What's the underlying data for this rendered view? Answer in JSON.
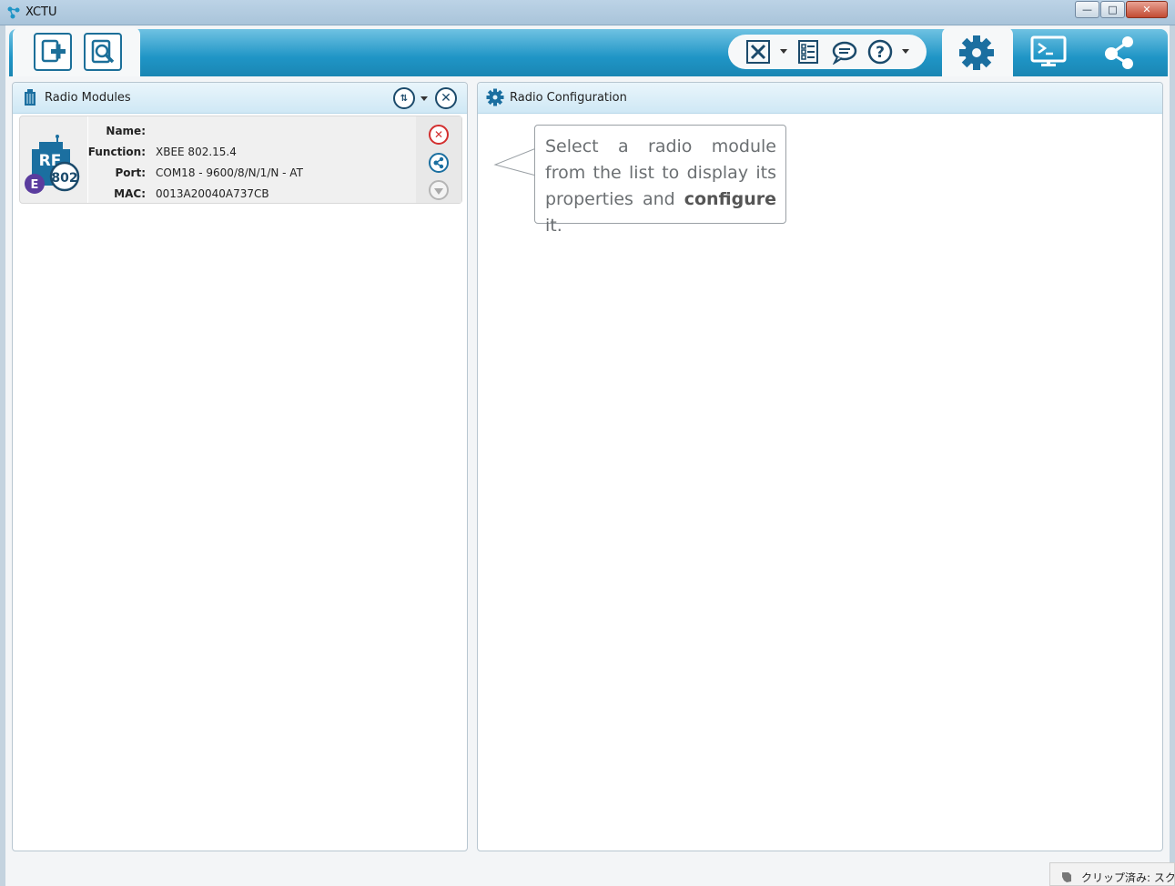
{
  "window": {
    "title": "XCTU"
  },
  "toolbar": {
    "add_device": "add-device",
    "discover_devices": "discover-devices",
    "tools": "tools",
    "profile": "profile",
    "feedback": "feedback",
    "help": "help",
    "config_mode": "configuration",
    "console_mode": "consoles",
    "network_mode": "network"
  },
  "left_panel": {
    "title": "Radio Modules",
    "module": {
      "name_label": "Name:",
      "name_value": "",
      "function_label": "Function:",
      "function_value": "XBEE 802.15.4",
      "port_label": "Port:",
      "port_value": "COM18 - 9600/8/N/1/N - AT",
      "mac_label": "MAC:",
      "mac_value": "0013A20040A737CB",
      "badge_text": "RF",
      "badge_num": "802",
      "badge_letter": "E"
    }
  },
  "right_panel": {
    "title": "Radio Configuration",
    "hint_part1": "Select a radio module from the list to display its properties and ",
    "hint_bold": "configure",
    "hint_part2": " it."
  },
  "status": {
    "text": "クリップ済み: スク"
  },
  "colors": {
    "accent": "#1f95c6",
    "dark": "#1b4a6b",
    "close_red": "#d32f2f"
  }
}
